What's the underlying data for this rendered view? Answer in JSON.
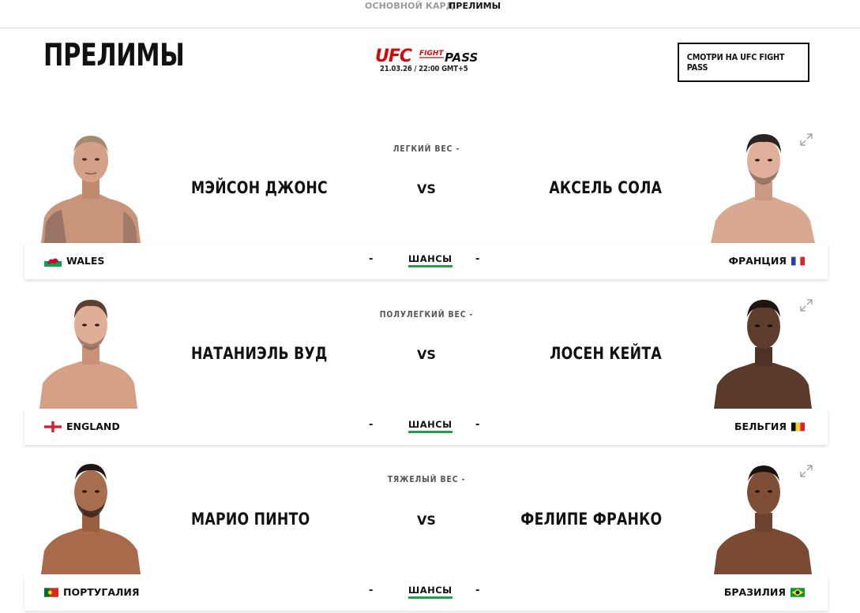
{
  "subnav": {
    "main_card": "ОСНОВНОЙ КАРД",
    "prelims": "ПРЕЛИМЫ"
  },
  "header": {
    "title": "ПРЕЛИМЫ",
    "logo_text": {
      "ufc": "UFC",
      "fight": "FIGHT",
      "pass": "PASS"
    },
    "date": "21.03.26 / 22:00 GMT+5",
    "watch_button": "СМОТРИ НА UFC FIGHT PASS"
  },
  "colors": {
    "ufc_red": "#d20a0a",
    "odds_underline": "#1ba34a"
  },
  "fights": [
    {
      "weight_class": "ЛЕГКИЙ ВЕС -",
      "red": {
        "name": "МЭЙСОН ДЖОНС",
        "country": "WALES",
        "flag": "wales-flag-icon",
        "odds": "-"
      },
      "blue": {
        "name": "АКСЕЛЬ СОЛА",
        "country": "ФРАНЦИЯ",
        "flag": "france-flag-icon",
        "odds": "-"
      },
      "vs": "VS",
      "odds_label": "ШАНСЫ"
    },
    {
      "weight_class": "ПОЛУЛЕГКИЙ ВЕС -",
      "red": {
        "name": "НАТАНИЭЛЬ ВУД",
        "country": "ENGLAND",
        "flag": "england-flag-icon",
        "odds": "-"
      },
      "blue": {
        "name": "ЛОСЕН КЕЙТА",
        "country": "БЕЛЬГИЯ",
        "flag": "belgium-flag-icon",
        "odds": "-"
      },
      "vs": "VS",
      "odds_label": "ШАНСЫ"
    },
    {
      "weight_class": "ТЯЖЕЛЫЙ ВЕС -",
      "red": {
        "name": "МАРИО ПИНТО",
        "country": "ПОРТУГАЛИЯ",
        "flag": "portugal-flag-icon",
        "odds": "-"
      },
      "blue": {
        "name": "ФЕЛИПЕ ФРАНКО",
        "country": "БРАЗИЛИЯ",
        "flag": "brazil-flag-icon",
        "odds": "-"
      },
      "vs": "VS",
      "odds_label": "ШАНСЫ"
    }
  ]
}
